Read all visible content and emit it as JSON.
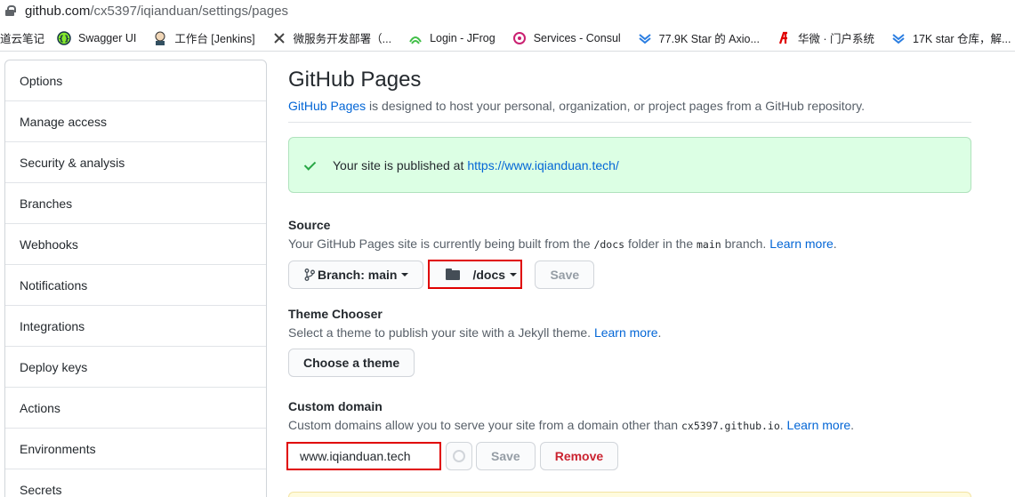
{
  "browser": {
    "url_host": "github.com",
    "url_path": "/cx5397/iqianduan/settings/pages"
  },
  "bookmarks": [
    {
      "label": "道云笔记",
      "icon": ""
    },
    {
      "label": "Swagger UI",
      "icon": "swagger-icon"
    },
    {
      "label": "工作台 [Jenkins]",
      "icon": "jenkins-icon"
    },
    {
      "label": "微服务开发部署（...",
      "icon": "x-icon"
    },
    {
      "label": "Login - JFrog",
      "icon": "jfrog-icon"
    },
    {
      "label": "Services - Consul",
      "icon": "consul-icon"
    },
    {
      "label": "77.9K Star 的 Axio...",
      "icon": "chevron-icon"
    },
    {
      "label": "华微 · 门户系统",
      "icon": "hw-icon"
    },
    {
      "label": "17K star 仓库，解...",
      "icon": "chevron-icon"
    }
  ],
  "sidebar": {
    "items": [
      {
        "label": "Options"
      },
      {
        "label": "Manage access"
      },
      {
        "label": "Security & analysis"
      },
      {
        "label": "Branches"
      },
      {
        "label": "Webhooks"
      },
      {
        "label": "Notifications"
      },
      {
        "label": "Integrations"
      },
      {
        "label": "Deploy keys"
      },
      {
        "label": "Actions"
      },
      {
        "label": "Environments"
      },
      {
        "label": "Secrets"
      }
    ]
  },
  "main": {
    "title": "GitHub Pages",
    "lead_link": "GitHub Pages",
    "lead_text": " is designed to host your personal, organization, or project pages from a GitHub repository.",
    "flash_text": "Your site is published at ",
    "flash_link": "https://www.iqianduan.tech/",
    "source": {
      "title": "Source",
      "desc_1": "Your GitHub Pages site is currently being built from the ",
      "folder_code": "/docs",
      "desc_2": " folder in the ",
      "branch_code": "main",
      "desc_3": " branch. ",
      "learn_more": "Learn more",
      "desc_end": ".",
      "branch_button": "Branch: main",
      "folder_button": "/docs",
      "save_button": "Save"
    },
    "theme": {
      "title": "Theme Chooser",
      "desc": "Select a theme to publish your site with a Jekyll theme. ",
      "learn_more": "Learn more",
      "desc_end": ".",
      "choose_button": "Choose a theme"
    },
    "domain": {
      "title": "Custom domain",
      "desc": "Custom domains allow you to serve your site from a domain other than ",
      "domain_code": "cx5397.github.io",
      "desc_2": ". ",
      "learn_more": "Learn more",
      "desc_end": ".",
      "input_value": "www.iqianduan.tech",
      "save_button": "Save",
      "remove_button": "Remove"
    }
  },
  "colors": {
    "link": "#0366d6",
    "success_bg": "#dcffe4",
    "danger": "#cb2431",
    "highlight": "#e00000"
  }
}
